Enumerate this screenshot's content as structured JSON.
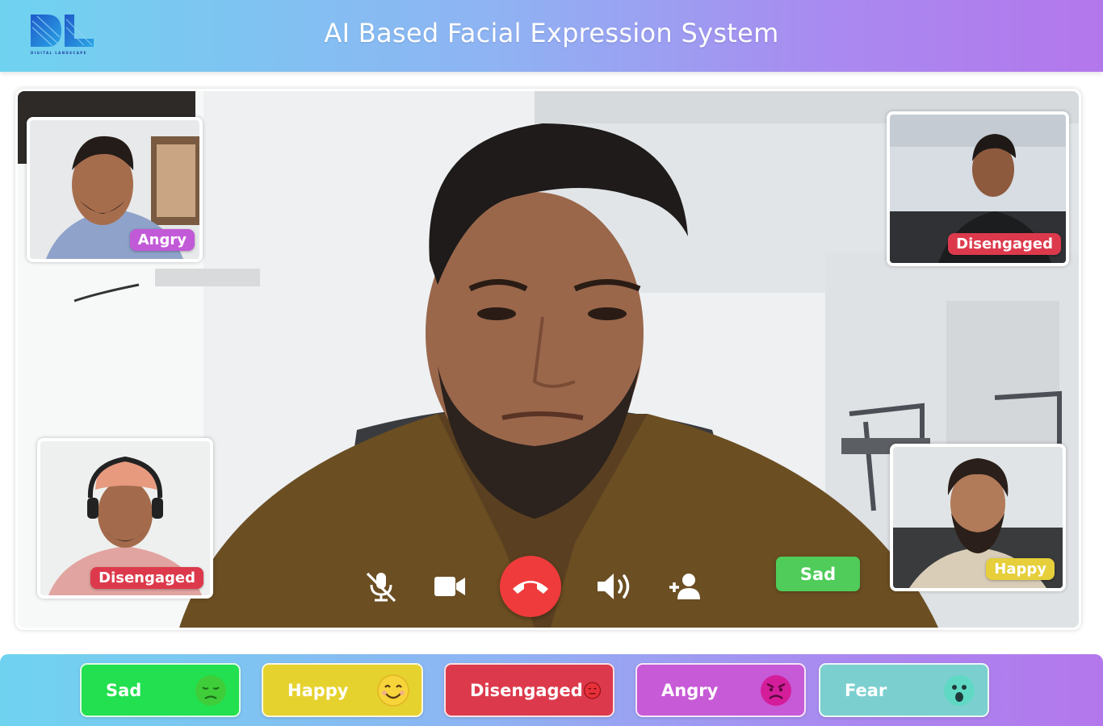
{
  "header": {
    "title": "AI Based Facial Expression System",
    "logo_text": "DIGITAL LANDSCAPE"
  },
  "participants": [
    {
      "position": "top-left",
      "label": "Angry",
      "color": "#c25ad8"
    },
    {
      "position": "top-right",
      "label": "Disengaged",
      "color": "#dc3a4c"
    },
    {
      "position": "bottom-left",
      "label": "Disengaged",
      "color": "#dc3a4c"
    },
    {
      "position": "bottom-right",
      "label": "Happy",
      "color": "#e6cf3a"
    }
  ],
  "main_speaker": {
    "label": "Sad",
    "color": "#4fcc5a"
  },
  "controls": {
    "mic": "mic-off-icon",
    "video": "video-camera-icon",
    "end_call": "phone-hangup-icon",
    "speaker": "volume-icon",
    "add_person": "add-person-icon"
  },
  "legend": [
    {
      "label": "Sad",
      "color": "#22e04f",
      "icon": "sad-face-icon"
    },
    {
      "label": "Happy",
      "color": "#e6d22e",
      "icon": "smile-face-icon"
    },
    {
      "label": "Disengaged",
      "color": "#dc3a4c",
      "icon": "neutral-face-icon"
    },
    {
      "label": "Angry",
      "color": "#c75ad6",
      "icon": "angry-face-icon"
    },
    {
      "label": "Fear",
      "color": "#7ccfcf",
      "icon": "fear-face-icon"
    }
  ]
}
